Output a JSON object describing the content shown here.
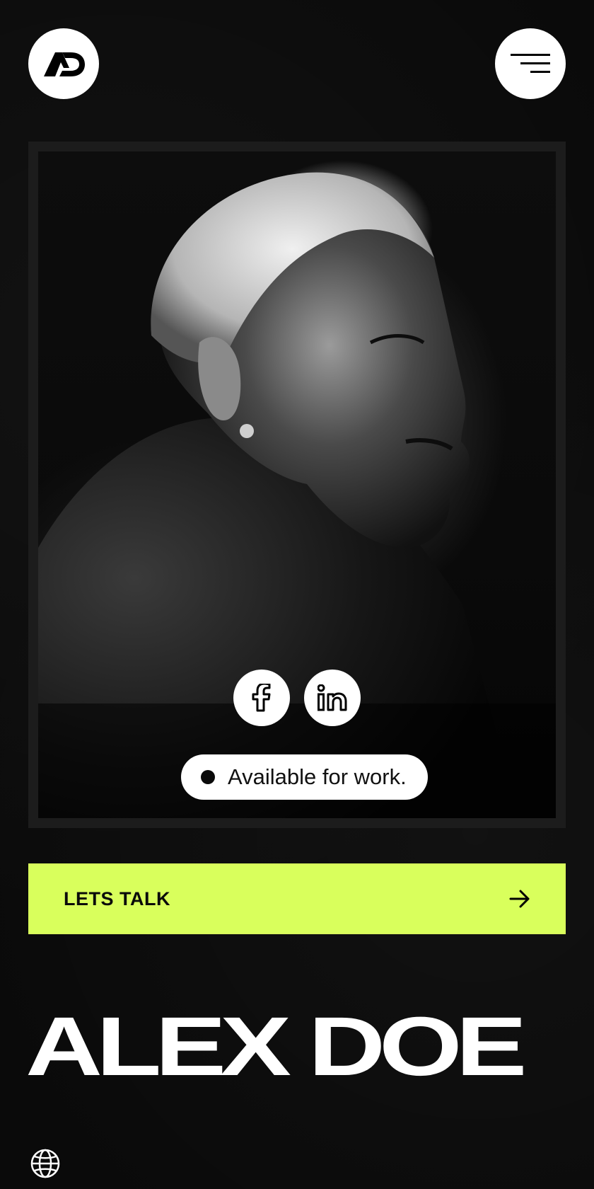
{
  "header": {
    "logo_icon": "ad-monogram-logo",
    "menu_icon": "hamburger-menu-icon"
  },
  "hero": {
    "socials": [
      {
        "icon": "facebook-icon"
      },
      {
        "icon": "linkedin-icon"
      }
    ],
    "status": {
      "label": "Available for work."
    }
  },
  "cta": {
    "label": "LETS TALK",
    "icon": "arrow-right-icon",
    "color": "#d9ff5c"
  },
  "name": "ALEX DOE",
  "footer": {
    "language_icon": "globe-icon"
  }
}
